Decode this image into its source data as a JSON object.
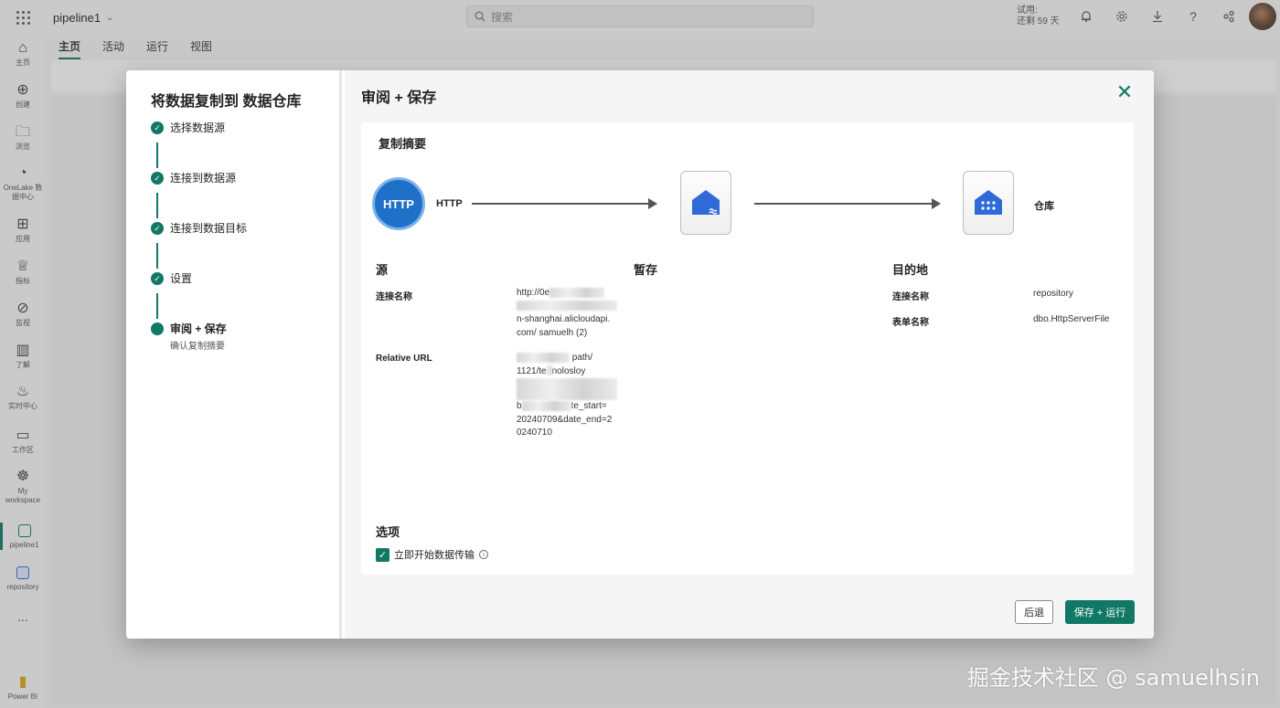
{
  "topbar": {
    "app_title": "pipeline1",
    "search_placeholder": "搜索",
    "trial_line1": "试用:",
    "trial_line2": "还剩 59 天"
  },
  "rail": {
    "items": [
      {
        "label": "主页",
        "icon": "home-icon"
      },
      {
        "label": "创建",
        "icon": "plus-circle-icon"
      },
      {
        "label": "浏览",
        "icon": "folder-icon"
      },
      {
        "label": "OneLake 数据中心",
        "icon": "onelake-icon"
      },
      {
        "label": "应用",
        "icon": "apps-icon"
      },
      {
        "label": "指标",
        "icon": "trophy-icon"
      },
      {
        "label": "监视",
        "icon": "monitor-icon"
      },
      {
        "label": "了解",
        "icon": "book-icon"
      },
      {
        "label": "实时中心",
        "icon": "realtime-icon"
      },
      {
        "label": "工作区",
        "icon": "workspace-icon"
      },
      {
        "label": "My workspace",
        "icon": "people-icon"
      },
      {
        "label": "pipeline1",
        "icon": "pipeline-icon"
      },
      {
        "label": "repository",
        "icon": "warehouse-icon"
      },
      {
        "label": "...",
        "icon": "more-icon"
      },
      {
        "label": "Power BI",
        "icon": "powerbi-icon"
      }
    ]
  },
  "ribbon": {
    "tabs": [
      "主页",
      "活动",
      "运行",
      "视图"
    ]
  },
  "dialog": {
    "wizard_title": "将数据复制到 数据仓库",
    "steps": [
      {
        "label": "选择数据源",
        "sub": ""
      },
      {
        "label": "连接到数据源",
        "sub": ""
      },
      {
        "label": "连接到数据目标",
        "sub": ""
      },
      {
        "label": "设置",
        "sub": ""
      },
      {
        "label": "审阅 + 保存",
        "sub": "确认复制摘要"
      }
    ],
    "title": "审阅 + 保存",
    "summary_title": "复制摘要",
    "http_icon_text": "HTTP",
    "source_label": "HTTP",
    "dest_label": "仓库",
    "source": {
      "heading": "源",
      "conn_key": "连接名称",
      "conn_line1": "http://0e",
      "conn_line3": "n-shanghai.alicloudapi.",
      "conn_line4": "com/ samuelh (2)",
      "url_key": "Relative URL",
      "url_line1": "path/",
      "url_line2": "1121/te",
      "url_line2b": "nolosloy",
      "url_line4a": "b",
      "url_line4b": "te_start=",
      "url_line5": "20240709&date_end=2",
      "url_line6": "0240710"
    },
    "staging": {
      "heading": "暂存"
    },
    "destination": {
      "heading": "目的地",
      "conn_key": "连接名称",
      "conn_val": "repository",
      "table_key": "表单名称",
      "table_val": "dbo.HttpServerFile"
    },
    "options": {
      "heading": "选项",
      "start_transfer": "立即开始数据传输",
      "start_transfer_checked": true
    },
    "back_label": "后退",
    "save_run_label": "保存 + 运行"
  },
  "watermark": "掘金技术社区 @ samuelhsin",
  "colors": {
    "accent": "#117865",
    "http_blue": "#1e70c8",
    "warehouse_blue": "#2f6bd8"
  }
}
